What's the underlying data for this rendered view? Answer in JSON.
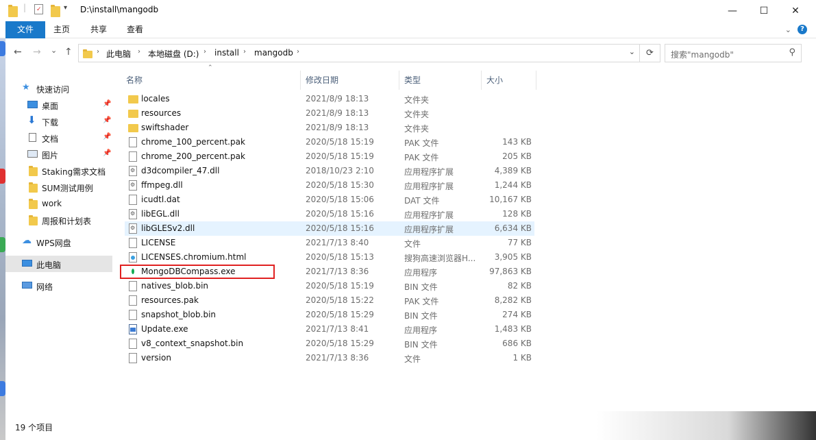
{
  "window": {
    "title": "D:\\install\\mangodb",
    "controls": {
      "minimize": "—",
      "maximize": "☐",
      "close": "✕"
    }
  },
  "ribbon": {
    "tabs": [
      "文件",
      "主页",
      "共享",
      "查看"
    ],
    "expand_icon": "chevron-down-icon",
    "help_label": "?"
  },
  "nav": {
    "back": "←",
    "forward": "→",
    "history": "⌄",
    "up": "↑",
    "breadcrumbs": [
      "此电脑",
      "本地磁盘 (D:)",
      "install",
      "mangodb"
    ],
    "search_placeholder": "搜索\"mangodb\""
  },
  "sidebar": {
    "items": [
      {
        "label": "快速访问",
        "icon": "star-icon",
        "pinned": false
      },
      {
        "label": "桌面",
        "icon": "desktop-icon",
        "pinned": true
      },
      {
        "label": "下载",
        "icon": "download-icon",
        "pinned": true
      },
      {
        "label": "文档",
        "icon": "document-icon",
        "pinned": true
      },
      {
        "label": "图片",
        "icon": "picture-icon",
        "pinned": true
      },
      {
        "label": "Staking需求文档",
        "icon": "folder-icon",
        "pinned": false
      },
      {
        "label": "SUM测试用例",
        "icon": "folder-icon",
        "pinned": false
      },
      {
        "label": "work",
        "icon": "folder-icon",
        "pinned": false
      },
      {
        "label": "周报和计划表",
        "icon": "folder-icon",
        "pinned": false
      },
      {
        "label": "WPS网盘",
        "icon": "cloud-icon",
        "pinned": false
      },
      {
        "label": "此电脑",
        "icon": "computer-icon",
        "pinned": false
      },
      {
        "label": "网络",
        "icon": "network-icon",
        "pinned": false
      }
    ]
  },
  "columns": {
    "name": "名称",
    "date": "修改日期",
    "type": "类型",
    "size": "大小"
  },
  "files": [
    {
      "name": "locales",
      "date": "2021/8/9 18:13",
      "type": "文件夹",
      "size": "",
      "icon": "folder-icon"
    },
    {
      "name": "resources",
      "date": "2021/8/9 18:13",
      "type": "文件夹",
      "size": "",
      "icon": "folder-icon"
    },
    {
      "name": "swiftshader",
      "date": "2021/8/9 18:13",
      "type": "文件夹",
      "size": "",
      "icon": "folder-icon"
    },
    {
      "name": "chrome_100_percent.pak",
      "date": "2020/5/18 15:19",
      "type": "PAK 文件",
      "size": "143 KB",
      "icon": "file-icon"
    },
    {
      "name": "chrome_200_percent.pak",
      "date": "2020/5/18 15:19",
      "type": "PAK 文件",
      "size": "205 KB",
      "icon": "file-icon"
    },
    {
      "name": "d3dcompiler_47.dll",
      "date": "2018/10/23 2:10",
      "type": "应用程序扩展",
      "size": "4,389 KB",
      "icon": "dll-icon"
    },
    {
      "name": "ffmpeg.dll",
      "date": "2020/5/18 15:30",
      "type": "应用程序扩展",
      "size": "1,244 KB",
      "icon": "dll-icon"
    },
    {
      "name": "icudtl.dat",
      "date": "2020/5/18 15:06",
      "type": "DAT 文件",
      "size": "10,167 KB",
      "icon": "file-icon"
    },
    {
      "name": "libEGL.dll",
      "date": "2020/5/18 15:16",
      "type": "应用程序扩展",
      "size": "128 KB",
      "icon": "dll-icon"
    },
    {
      "name": "libGLESv2.dll",
      "date": "2020/5/18 15:16",
      "type": "应用程序扩展",
      "size": "6,634 KB",
      "icon": "dll-icon"
    },
    {
      "name": "LICENSE",
      "date": "2021/7/13 8:40",
      "type": "文件",
      "size": "77 KB",
      "icon": "file-icon"
    },
    {
      "name": "LICENSES.chromium.html",
      "date": "2020/5/18 15:13",
      "type": "搜狗高速浏览器H...",
      "size": "3,905 KB",
      "icon": "html-icon"
    },
    {
      "name": "MongoDBCompass.exe",
      "date": "2021/7/13 8:36",
      "type": "应用程序",
      "size": "97,863 KB",
      "icon": "mongodb-leaf-icon"
    },
    {
      "name": "natives_blob.bin",
      "date": "2020/5/18 15:19",
      "type": "BIN 文件",
      "size": "82 KB",
      "icon": "file-icon"
    },
    {
      "name": "resources.pak",
      "date": "2020/5/18 15:22",
      "type": "PAK 文件",
      "size": "8,282 KB",
      "icon": "file-icon"
    },
    {
      "name": "snapshot_blob.bin",
      "date": "2020/5/18 15:29",
      "type": "BIN 文件",
      "size": "274 KB",
      "icon": "file-icon"
    },
    {
      "name": "Update.exe",
      "date": "2021/7/13 8:41",
      "type": "应用程序",
      "size": "1,483 KB",
      "icon": "update-exe-icon"
    },
    {
      "name": "v8_context_snapshot.bin",
      "date": "2020/5/18 15:29",
      "type": "BIN 文件",
      "size": "686 KB",
      "icon": "file-icon"
    },
    {
      "name": "version",
      "date": "2021/7/13 8:36",
      "type": "文件",
      "size": "1 KB",
      "icon": "file-icon"
    }
  ],
  "hovered_row": "libGLESv2.dll",
  "highlighted_row": "MongoDBCompass.exe",
  "status": {
    "item_count": "19 个项目"
  },
  "colors": {
    "accent": "#1979ca",
    "highlight_box": "#e02020",
    "hover": "#e5f3ff",
    "folder": "#f2c94c"
  }
}
